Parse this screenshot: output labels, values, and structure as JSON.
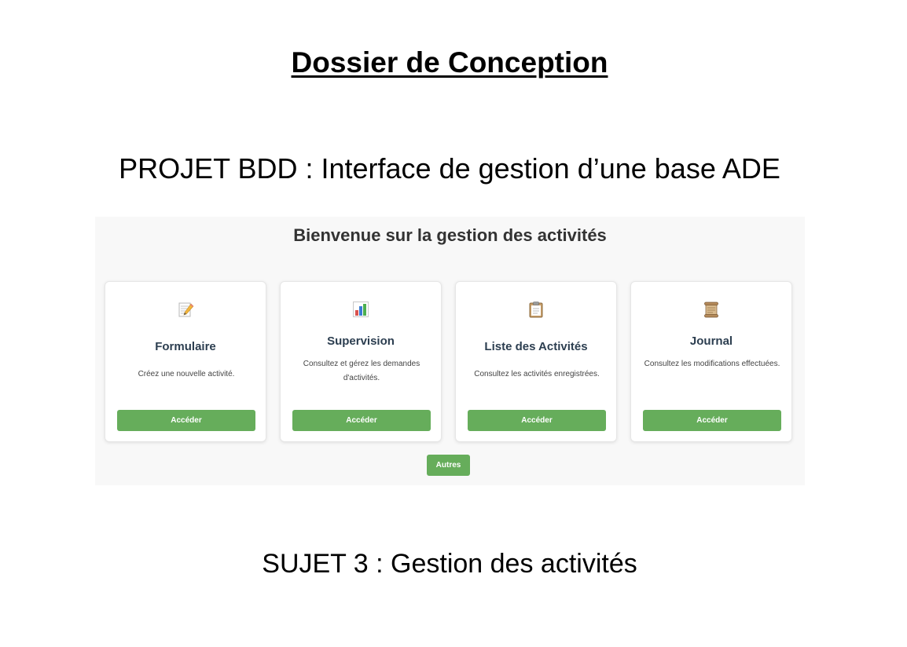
{
  "document": {
    "title": "Dossier de Conception",
    "project": "PROJET BDD : Interface de gestion d’une base ADE",
    "subject": "SUJET 3 : Gestion des activités"
  },
  "app": {
    "heading": "Bienvenue sur la gestion des activités",
    "cards": [
      {
        "icon": "memo-pencil-icon",
        "title": "Formulaire",
        "description": "Créez une nouvelle activité.",
        "button": "Accéder"
      },
      {
        "icon": "bar-chart-icon",
        "title": "Supervision",
        "description": "Consultez et gérez les demandes d'activités.",
        "button": "Accéder"
      },
      {
        "icon": "clipboard-icon",
        "title": "Liste des Activités",
        "description": "Consultez les activités enregistrées.",
        "button": "Accéder"
      },
      {
        "icon": "scroll-icon",
        "title": "Journal",
        "description": "Consultez les modifications effectuées.",
        "button": "Accéder"
      }
    ],
    "other_button": "Autres",
    "colors": {
      "button": "#66ad5b",
      "card_title": "#2c3e50",
      "panel_background": "#f8f8f8"
    }
  }
}
